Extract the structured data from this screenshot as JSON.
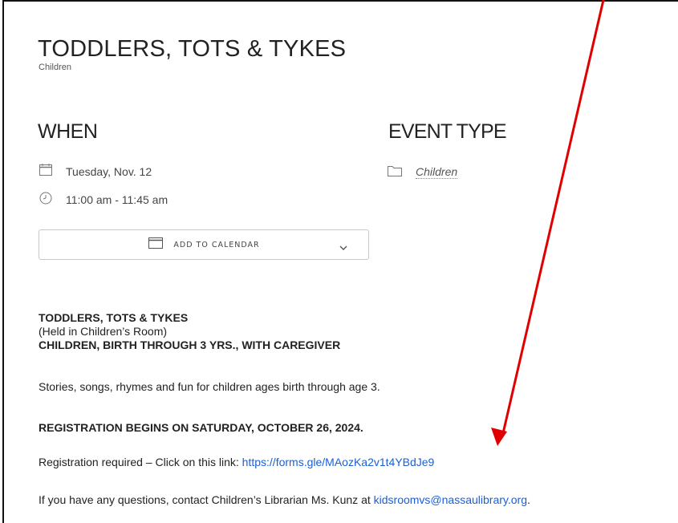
{
  "event": {
    "title": "TODDLERS, TOTS & TYKES",
    "category": "Children"
  },
  "when": {
    "heading": "WHEN",
    "date": "Tuesday, Nov. 12",
    "time": "11:00 am - 11:45 am",
    "add_to_calendar_label": "ADD TO CALENDAR"
  },
  "event_type": {
    "heading": "EVENT TYPE",
    "value": "Children"
  },
  "description": {
    "line1": "TODDLERS, TOTS & TYKES",
    "line2": "(Held in Children’s Room)",
    "line3": "CHILDREN, BIRTH THROUGH 3 YRS., WITH CAREGIVER",
    "summary": "Stories, songs, rhymes and fun for children ages birth through age 3.",
    "registration_notice": "REGISTRATION BEGINS ON SATURDAY, OCTOBER 26, 2024.",
    "registration_prefix": "Registration required – Click on this link: ",
    "registration_link": "https://forms.gle/MAozKa2v1t4YBdJe9",
    "contact_prefix": "If you have any questions, contact Children’s Librarian Ms. Kunz at ",
    "contact_email": "kidsroomvs@nassaulibrary.org",
    "contact_suffix": "."
  },
  "colors": {
    "link": "#1a5fd6",
    "annotation_arrow": "#e00000"
  }
}
